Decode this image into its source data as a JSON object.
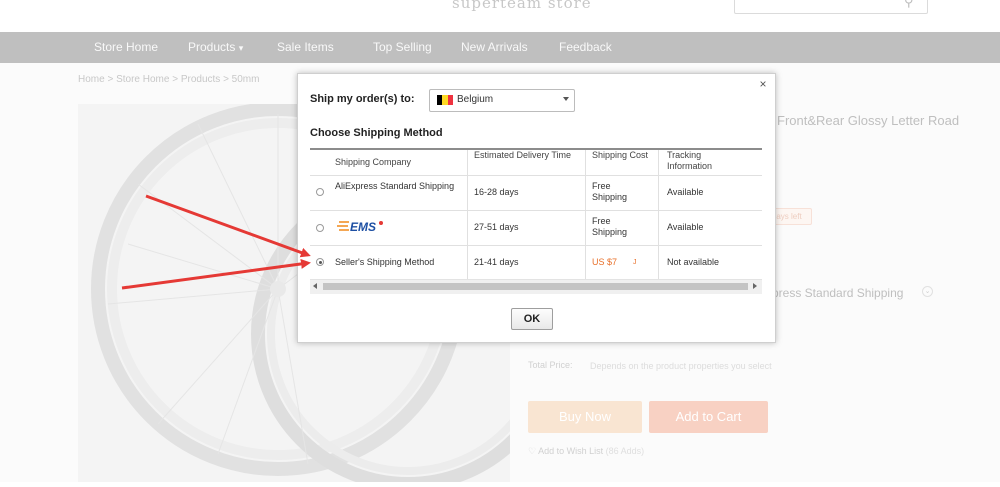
{
  "header": {
    "store_name": "superteam store"
  },
  "nav": {
    "items": [
      "Store Home",
      "Products",
      "Sale Items",
      "Top Selling",
      "New Arrivals",
      "Feedback"
    ],
    "products_caret": "▾"
  },
  "breadcrumb": "Home > Store Home > Products > 50mm",
  "product": {
    "title_fragment": "Front&Rear Glossy Letter Road",
    "days_left": "ays left",
    "shipping_summary": "xpress Standard Shipping",
    "total_label": "Total Price:",
    "total_value": "Depends on the product properties you select",
    "buy_now": "Buy Now",
    "add_to_cart": "Add to Cart",
    "wish_list": "Add to Wish List",
    "wish_count": "(86 Adds)"
  },
  "modal": {
    "close_glyph": "×",
    "ship_to_label": "Ship my order(s) to:",
    "country": "Belgium",
    "flag_colors": [
      "#000000",
      "#FDDA24",
      "#EF3340"
    ],
    "method_heading": "Choose Shipping Method",
    "columns": [
      "Shipping Company",
      "Estimated Delivery Time",
      "Shipping Cost",
      "Tracking Information"
    ],
    "rows": [
      {
        "company": "AliExpress Standard Shipping",
        "delivery": "16-28 days",
        "cost": "Free Shipping",
        "tracking": "Available",
        "selected": false
      },
      {
        "company": "EMS",
        "company_logo": "ems-logo",
        "delivery": "27-51 days",
        "cost": "Free Shipping",
        "tracking": "Available",
        "selected": false
      },
      {
        "company": "Seller's Shipping Method",
        "delivery": "21-41 days",
        "cost": "US $7",
        "cost_tail": "J",
        "tracking": "Not available",
        "selected": true
      }
    ],
    "ok_label": "OK"
  },
  "annotations": {
    "arrow_color": "#e53935"
  }
}
